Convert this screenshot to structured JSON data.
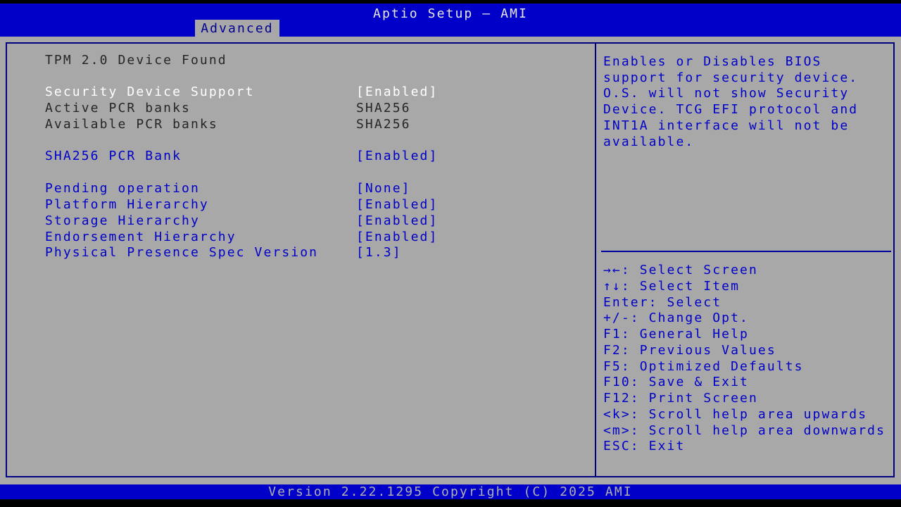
{
  "window": {
    "title": "Aptio Setup – AMI",
    "footer": "Version 2.22.1295 Copyright (C) 2025 AMI"
  },
  "tabs": {
    "active": "Advanced"
  },
  "settings": {
    "status": "TPM 2.0 Device Found",
    "rows": [
      {
        "label": "Security Device Support",
        "value": "[Enabled]",
        "state": "selected"
      },
      {
        "label": "Active PCR banks",
        "value": "SHA256",
        "state": "info"
      },
      {
        "label": "Available PCR banks",
        "value": "SHA256",
        "state": "info"
      },
      {
        "label": "SHA256 PCR Bank",
        "value": "[Enabled]",
        "state": "option"
      },
      {
        "label": "Pending operation",
        "value": "[None]",
        "state": "option"
      },
      {
        "label": "Platform Hierarchy",
        "value": "[Enabled]",
        "state": "option"
      },
      {
        "label": "Storage Hierarchy",
        "value": "[Enabled]",
        "state": "option"
      },
      {
        "label": "Endorsement Hierarchy",
        "value": "[Enabled]",
        "state": "option"
      },
      {
        "label": "Physical Presence Spec Version",
        "value": "[1.3]",
        "state": "option"
      }
    ]
  },
  "help": {
    "text": "Enables or Disables BIOS support for security device. O.S. will not show Security Device. TCG EFI protocol and INT1A interface will not be available."
  },
  "hotkeys": [
    "→←: Select Screen",
    "↑↓: Select Item",
    "Enter: Select",
    "+/-: Change Opt.",
    "F1: General Help",
    "F2: Previous Values",
    "F5: Optimized Defaults",
    "F10: Save & Exit",
    "F12: Print Screen",
    "<k>: Scroll help area upwards",
    "<m>: Scroll help area downwards",
    "ESC: Exit"
  ],
  "colors": {
    "header_blue": "#0000c8",
    "background_gray": "#a8a8a8",
    "border_navy": "#000080",
    "option_blue": "#0000c8",
    "selected_white": "#ffffff",
    "info_dark": "#262626"
  }
}
